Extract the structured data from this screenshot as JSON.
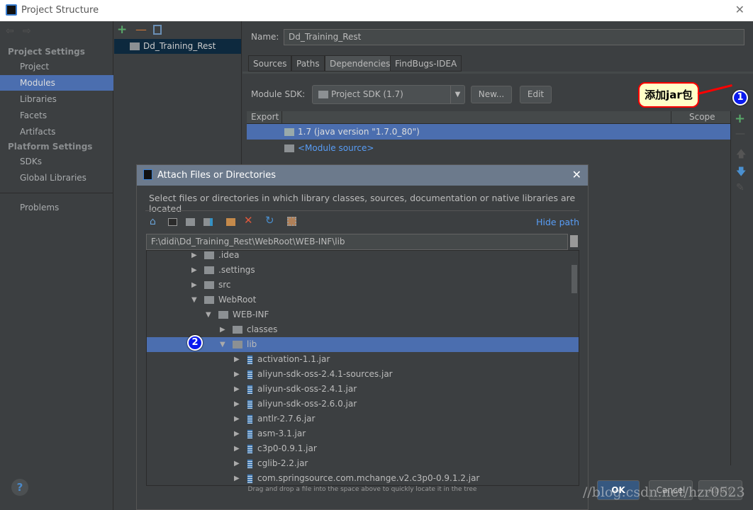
{
  "window": {
    "title": "Project Structure"
  },
  "sidebar": {
    "project_settings": "Project Settings",
    "items1": [
      "Project",
      "Modules",
      "Libraries",
      "Facets",
      "Artifacts"
    ],
    "platform_settings": "Platform Settings",
    "items2": [
      "SDKs",
      "Global Libraries"
    ],
    "problems": "Problems"
  },
  "modules": {
    "selected": "Dd_Training_Rest"
  },
  "module": {
    "name_label": "Name:",
    "name_value": "Dd_Training_Rest",
    "tabs": [
      "Sources",
      "Paths",
      "Dependencies",
      "FindBugs-IDEA"
    ],
    "active_tab": "Dependencies",
    "sdk_label": "Module SDK:",
    "sdk_value": "Project SDK (1.7)",
    "new_button": "New...",
    "edit_button": "Edit",
    "col_export": "Export",
    "col_scope": "Scope",
    "rows": [
      "1.7 (java version \"1.7.0_80\")",
      "<Module source>"
    ]
  },
  "annotation": {
    "callout": "添加jar包",
    "badge1": "1",
    "badge2": "2"
  },
  "dialog": {
    "title": "Attach Files or Directories",
    "description": "Select files or directories in which library classes, sources, documentation or native libraries are located",
    "hide_path": "Hide path",
    "path": "F:\\didi\\Dd_Training_Rest\\WebRoot\\WEB-INF\\lib",
    "hint": "Drag and drop a file into the space above to quickly locate it in the tree",
    "tree": [
      {
        "label": ".idea",
        "depth": 0,
        "type": "folder",
        "expanded": false
      },
      {
        "label": ".settings",
        "depth": 0,
        "type": "folder",
        "expanded": false
      },
      {
        "label": "src",
        "depth": 0,
        "type": "folder",
        "expanded": false
      },
      {
        "label": "WebRoot",
        "depth": 0,
        "type": "folder",
        "expanded": true
      },
      {
        "label": "WEB-INF",
        "depth": 1,
        "type": "folder",
        "expanded": true
      },
      {
        "label": "classes",
        "depth": 2,
        "type": "folder",
        "expanded": false
      },
      {
        "label": "lib",
        "depth": 2,
        "type": "folder",
        "expanded": true,
        "selected": true
      },
      {
        "label": "activation-1.1.jar",
        "depth": 3,
        "type": "jar"
      },
      {
        "label": "aliyun-sdk-oss-2.4.1-sources.jar",
        "depth": 3,
        "type": "jar"
      },
      {
        "label": "aliyun-sdk-oss-2.4.1.jar",
        "depth": 3,
        "type": "jar"
      },
      {
        "label": "aliyun-sdk-oss-2.6.0.jar",
        "depth": 3,
        "type": "jar"
      },
      {
        "label": "antlr-2.7.6.jar",
        "depth": 3,
        "type": "jar"
      },
      {
        "label": "asm-3.1.jar",
        "depth": 3,
        "type": "jar"
      },
      {
        "label": "c3p0-0.9.1.jar",
        "depth": 3,
        "type": "jar"
      },
      {
        "label": "cglib-2.2.jar",
        "depth": 3,
        "type": "jar"
      },
      {
        "label": "com.springsource.com.mchange.v2.c3p0-0.9.1.2.jar",
        "depth": 3,
        "type": "jar"
      }
    ]
  },
  "footer": {
    "ok": "OK",
    "cancel": "Cancel",
    "apply": "Apply",
    "help": "?",
    "watermark": "//blog.csdn.net/hzr0523"
  },
  "colors": {
    "selection": "#4b6eaf",
    "badge": "#0a1aef",
    "callout_bg": "#ffffc8",
    "callout_border": "#ff0000",
    "link": "#589df6"
  }
}
